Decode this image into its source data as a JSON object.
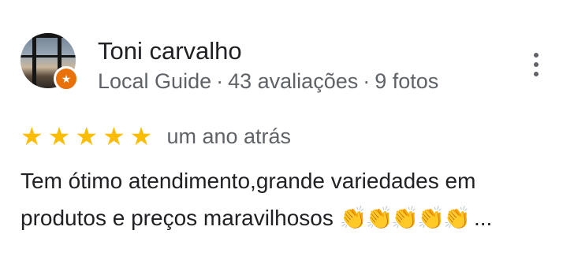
{
  "reviewer": {
    "name": "Toni carvalho",
    "badge": "Local Guide",
    "separator": "·",
    "reviews_count": "43 avaliações",
    "photos_count": "9 fotos"
  },
  "rating": {
    "stars": 5,
    "max_stars": 5,
    "star_glyph": "★",
    "date": "um ano atrás"
  },
  "review": {
    "text": "Tem ótimo atendimento,grande variedades em produtos e preços maravilhosos",
    "emojis": "👏👏👏👏👏",
    "ellipsis": "..."
  },
  "icons": {
    "avatar": "profile-photo",
    "badge": "local-guide-star-icon",
    "menu": "more-vert-icon"
  },
  "colors": {
    "star": "#fbbc04",
    "badge": "#e8710a",
    "secondary_text": "#5f6368",
    "primary_text": "#202124"
  }
}
